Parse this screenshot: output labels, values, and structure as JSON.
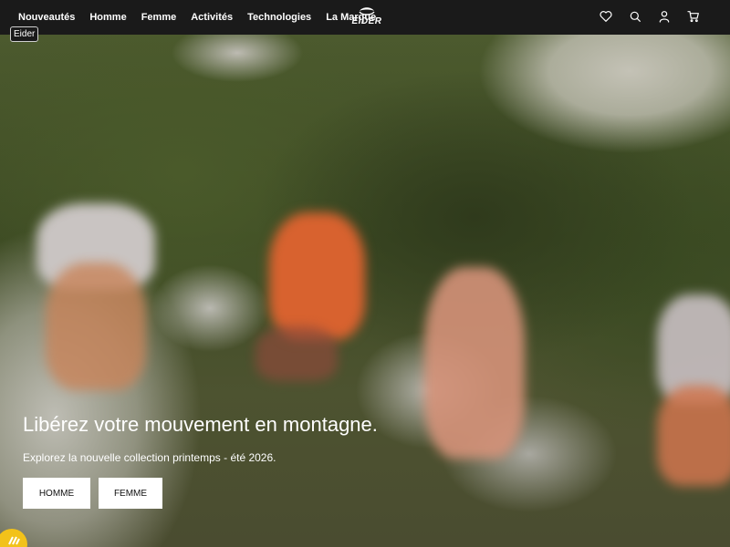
{
  "nav": {
    "items": [
      {
        "label": "Nouveautés"
      },
      {
        "label": "Homme"
      },
      {
        "label": "Femme"
      },
      {
        "label": "Activités"
      },
      {
        "label": "Technologies"
      },
      {
        "label": "La Marque"
      }
    ]
  },
  "logo": {
    "text": "EIDER"
  },
  "header_icons": [
    "heart-icon",
    "search-icon",
    "user-icon",
    "cart-icon"
  ],
  "brand_tag": "Eider",
  "hero": {
    "title": "Libérez votre mouvement en montagne.",
    "subtitle": "Explorez la nouvelle collection printemps - été 2026.",
    "buttons": {
      "homme": "HOMME",
      "femme": "FEMME"
    }
  },
  "colors": {
    "header_bg": "#1a1a1a",
    "badge": "#f2c21a",
    "button_bg": "#ffffff"
  }
}
